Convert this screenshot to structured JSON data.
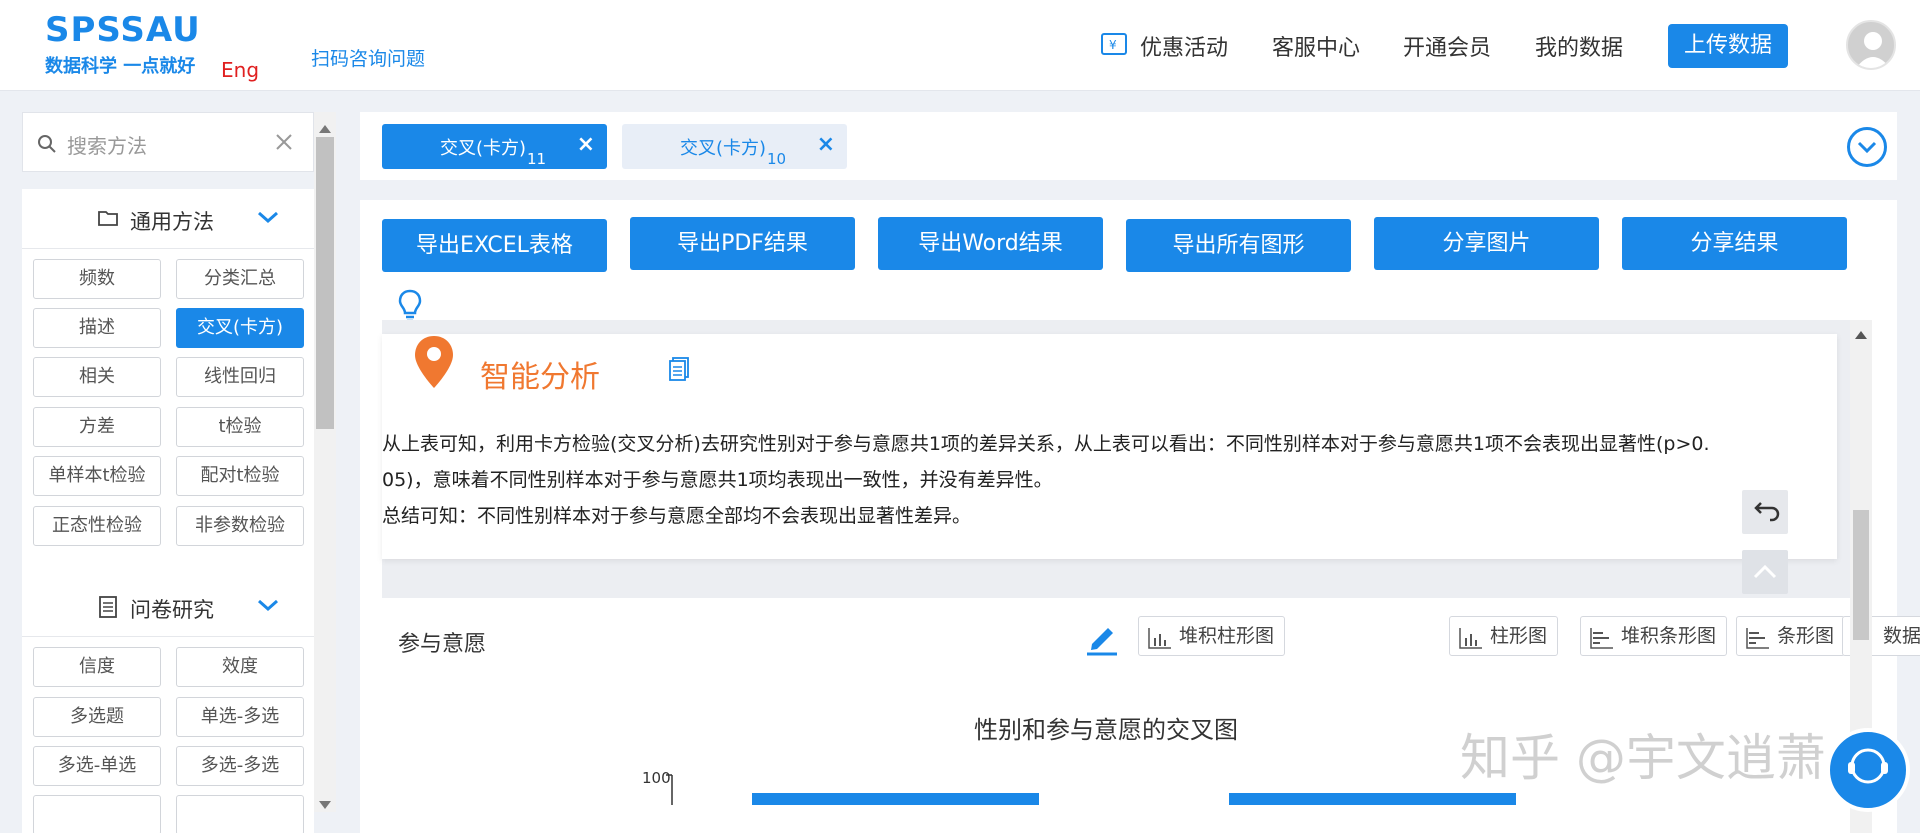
{
  "header": {
    "logo_title": "SPSSAU",
    "logo_sub": "数据科学 一点就好",
    "lang_link": "Eng",
    "scan_link": "扫码咨询问题",
    "nav": [
      "优惠活动",
      "客服中心",
      "开通会员",
      "我的数据"
    ],
    "upload_label": "上传数据"
  },
  "sidebar": {
    "search_placeholder": "搜索方法",
    "sections": [
      {
        "title": "通用方法",
        "items": [
          "频数",
          "分类汇总",
          "描述",
          "交叉(卡方)",
          "相关",
          "线性回归",
          "方差",
          "t检验",
          "单样本t检验",
          "配对t检验",
          "正态性检验",
          "非参数检验"
        ],
        "active": "交叉(卡方)"
      },
      {
        "title": "问卷研究",
        "items": [
          "信度",
          "效度",
          "多选题",
          "单选-多选",
          "多选-单选",
          "多选-多选"
        ]
      }
    ]
  },
  "tabs": [
    {
      "label": "交叉(卡方)",
      "number": "11",
      "active": true
    },
    {
      "label": "交叉(卡方)",
      "number": "10",
      "active": false
    }
  ],
  "toolbar": {
    "buttons": [
      "导出EXCEL表格",
      "导出PDF结果",
      "导出Word结果",
      "导出所有图形",
      "分享图片",
      "分享结果"
    ]
  },
  "analysis": {
    "title": "智能分析",
    "line1": "从上表可知，利用卡方检验(交叉分析)去研究性别对于参与意愿共1项的差异关系，从上表可以看出：不同性别样本对于参与意愿共1项不会表现出显著性(p>0.",
    "line2": "05)，意味着不同性别样本对于参与意愿共1项均表现出一致性，并没有差异性。",
    "line3": "总结可知：不同性别样本对于参与意愿全部均不会表现出显著性差异。"
  },
  "chart_section": {
    "label": "参与意愿",
    "tools": [
      "堆积柱形图",
      "柱形图",
      "堆积条形图",
      "条形图",
      "数据"
    ],
    "chart_title": "性别和参与意愿的交叉图",
    "y_tick_top": "100"
  },
  "watermark": "知乎 @宇文逍萧",
  "colors": {
    "accent": "#1a88e8",
    "orange": "#f07830"
  }
}
